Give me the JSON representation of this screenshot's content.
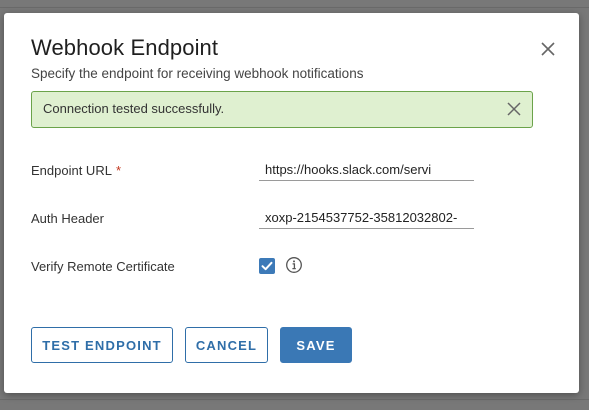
{
  "dialog": {
    "title": "Webhook Endpoint",
    "subtitle": "Specify the endpoint for receiving webhook notifications",
    "close_icon": "close-icon"
  },
  "alert": {
    "message": "Connection tested successfully.",
    "close_icon": "close-icon",
    "status": "success",
    "color": "#dff0d0"
  },
  "form": {
    "endpoint_url": {
      "label": "Endpoint URL",
      "required_marker": "*",
      "value": "https://hooks.slack.com/servi"
    },
    "auth_header": {
      "label": "Auth Header",
      "value": "xoxp-2154537752-35812032802-"
    },
    "verify_certificate": {
      "label": "Verify Remote Certificate",
      "checked": true,
      "info_icon": "info-icon"
    }
  },
  "buttons": {
    "test": "TEST ENDPOINT",
    "cancel": "CANCEL",
    "save": "SAVE"
  },
  "colors": {
    "accent": "#3a78b5",
    "required": "#c2371e",
    "success_border": "#6ba34a"
  }
}
